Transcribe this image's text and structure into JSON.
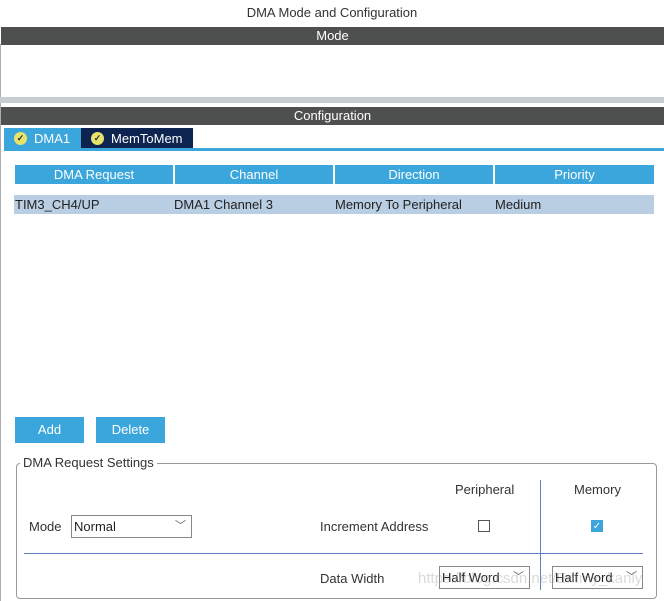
{
  "window": {
    "title": "DMA Mode and Configuration"
  },
  "sections": {
    "mode": "Mode",
    "configuration": "Configuration"
  },
  "tabs": [
    {
      "label": "DMA1",
      "active": true
    },
    {
      "label": "MemToMem",
      "active": false
    }
  ],
  "table": {
    "columns": [
      "DMA Request",
      "Channel",
      "Direction",
      "Priority"
    ],
    "rows": [
      [
        "TIM3_CH4/UP",
        "DMA1 Channel 3",
        "Memory To Peripheral",
        "Medium"
      ]
    ]
  },
  "buttons": {
    "add": "Add",
    "delete": "Delete"
  },
  "settings": {
    "legend": "DMA Request Settings",
    "peripheral_header": "Peripheral",
    "memory_header": "Memory",
    "mode_label": "Mode",
    "mode_value": "Normal",
    "increment_label": "Increment Address",
    "increment_peripheral": false,
    "increment_memory": true,
    "data_width_label": "Data Width",
    "peripheral_width": "Half Word",
    "memory_width": "Half Word"
  },
  "watermark": "https://blog.csdn.net/Emmy_kanly",
  "colors": {
    "accent": "#3aa6db",
    "header_bar": "#4e4f4f",
    "selected_row": "#b9cde3",
    "active_tab": "#3aa6db",
    "inactive_tab": "#0d2350"
  }
}
